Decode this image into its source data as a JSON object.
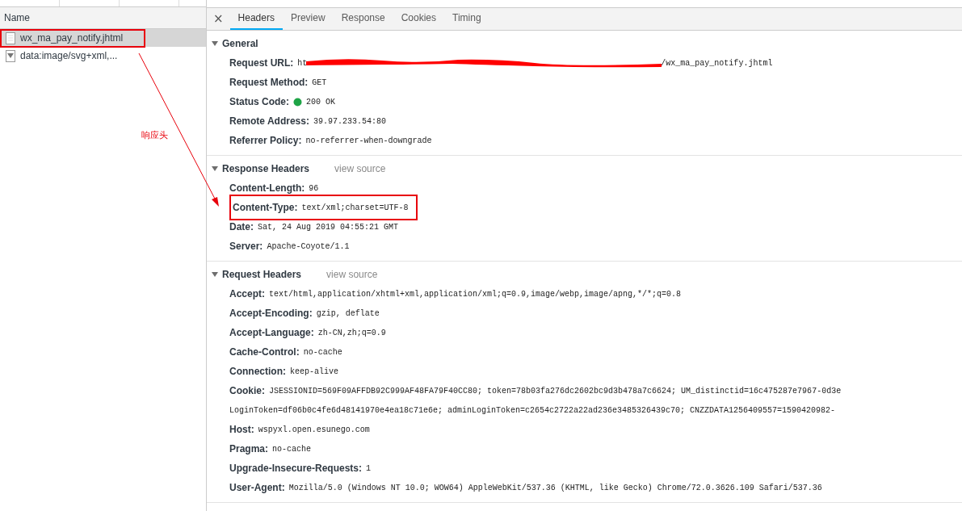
{
  "requests": {
    "column": "Name",
    "items": [
      {
        "name": "wx_ma_pay_notify.jhtml",
        "kind": "document",
        "selected": true,
        "highlighted": true
      },
      {
        "name": "data:image/svg+xml,...",
        "kind": "image",
        "selected": false,
        "highlighted": false
      }
    ]
  },
  "close": "×",
  "tabs": [
    {
      "label": "Headers",
      "selected": true
    },
    {
      "label": "Preview",
      "selected": false
    },
    {
      "label": "Response",
      "selected": false
    },
    {
      "label": "Cookies",
      "selected": false
    },
    {
      "label": "Timing",
      "selected": false
    }
  ],
  "sections": [
    {
      "title": "General",
      "expanded": true,
      "rows": [
        {
          "name": "Request URL:",
          "kind": "redacted",
          "prefix": "ht",
          "value": "/wx_ma_pay_notify.jhtml",
          "highlighted": false
        },
        {
          "name": "Request Method:",
          "kind": "plain",
          "value": "GET",
          "highlighted": false
        },
        {
          "name": "Status Code:",
          "kind": "status",
          "value": "200 OK",
          "highlighted": false
        },
        {
          "name": "Remote Address:",
          "kind": "plain",
          "value": "39.97.233.54:80",
          "highlighted": false
        },
        {
          "name": "Referrer Policy:",
          "kind": "plain",
          "value": "no-referrer-when-downgrade",
          "highlighted": false
        }
      ]
    },
    {
      "title": "Response Headers",
      "link": "view source",
      "expanded": true,
      "rows": [
        {
          "name": "Content-Length:",
          "kind": "plain",
          "value": "96",
          "highlighted": false
        },
        {
          "name": "Content-Type:",
          "kind": "plain",
          "value": "text/xml;charset=UTF-8",
          "highlighted": true
        },
        {
          "name": "Date:",
          "kind": "plain",
          "value": "Sat, 24 Aug 2019 04:55:21 GMT",
          "highlighted": false
        },
        {
          "name": "Server:",
          "kind": "plain",
          "value": "Apache-Coyote/1.1",
          "highlighted": false
        }
      ]
    },
    {
      "title": "Request Headers",
      "link": "view source",
      "expanded": true,
      "rows": [
        {
          "name": "Accept:",
          "kind": "plain",
          "value": "text/html,application/xhtml+xml,application/xml;q=0.9,image/webp,image/apng,*/*;q=0.8",
          "highlighted": false
        },
        {
          "name": "Accept-Encoding:",
          "kind": "plain",
          "value": "gzip, deflate",
          "highlighted": false
        },
        {
          "name": "Accept-Language:",
          "kind": "plain",
          "value": "zh-CN,zh;q=0.9",
          "highlighted": false
        },
        {
          "name": "Cache-Control:",
          "kind": "plain",
          "value": "no-cache",
          "highlighted": false
        },
        {
          "name": "Connection:",
          "kind": "plain",
          "value": "keep-alive",
          "highlighted": false
        },
        {
          "name": "Cookie:",
          "kind": "multiline",
          "value": "JSESSIONID=569F09AFFDB92C999AF48FA79F40CC80; token=78b03fa276dc2602bc9d3b478a7c6624; UM_distinctid=16c475287e7967-0d3e",
          "continuation": "LoginToken=df06b0c4fe6d48141970e4ea18c71e6e; adminLoginToken=c2654c2722a22ad236e3485326439c70; CNZZDATA1256409557=1590420982-",
          "highlighted": false
        },
        {
          "name": "Host:",
          "kind": "plain",
          "value": "wspyxl.open.esunego.com",
          "highlighted": false
        },
        {
          "name": "Pragma:",
          "kind": "plain",
          "value": "no-cache",
          "highlighted": false
        },
        {
          "name": "Upgrade-Insecure-Requests:",
          "kind": "plain",
          "value": "1",
          "highlighted": false
        },
        {
          "name": "User-Agent:",
          "kind": "plain",
          "value": "Mozilla/5.0 (Windows NT 10.0; WOW64) AppleWebKit/537.36 (KHTML, like Gecko) Chrome/72.0.3626.109 Safari/537.36",
          "highlighted": false
        }
      ]
    }
  ],
  "annotation": {
    "label": "响应头"
  }
}
